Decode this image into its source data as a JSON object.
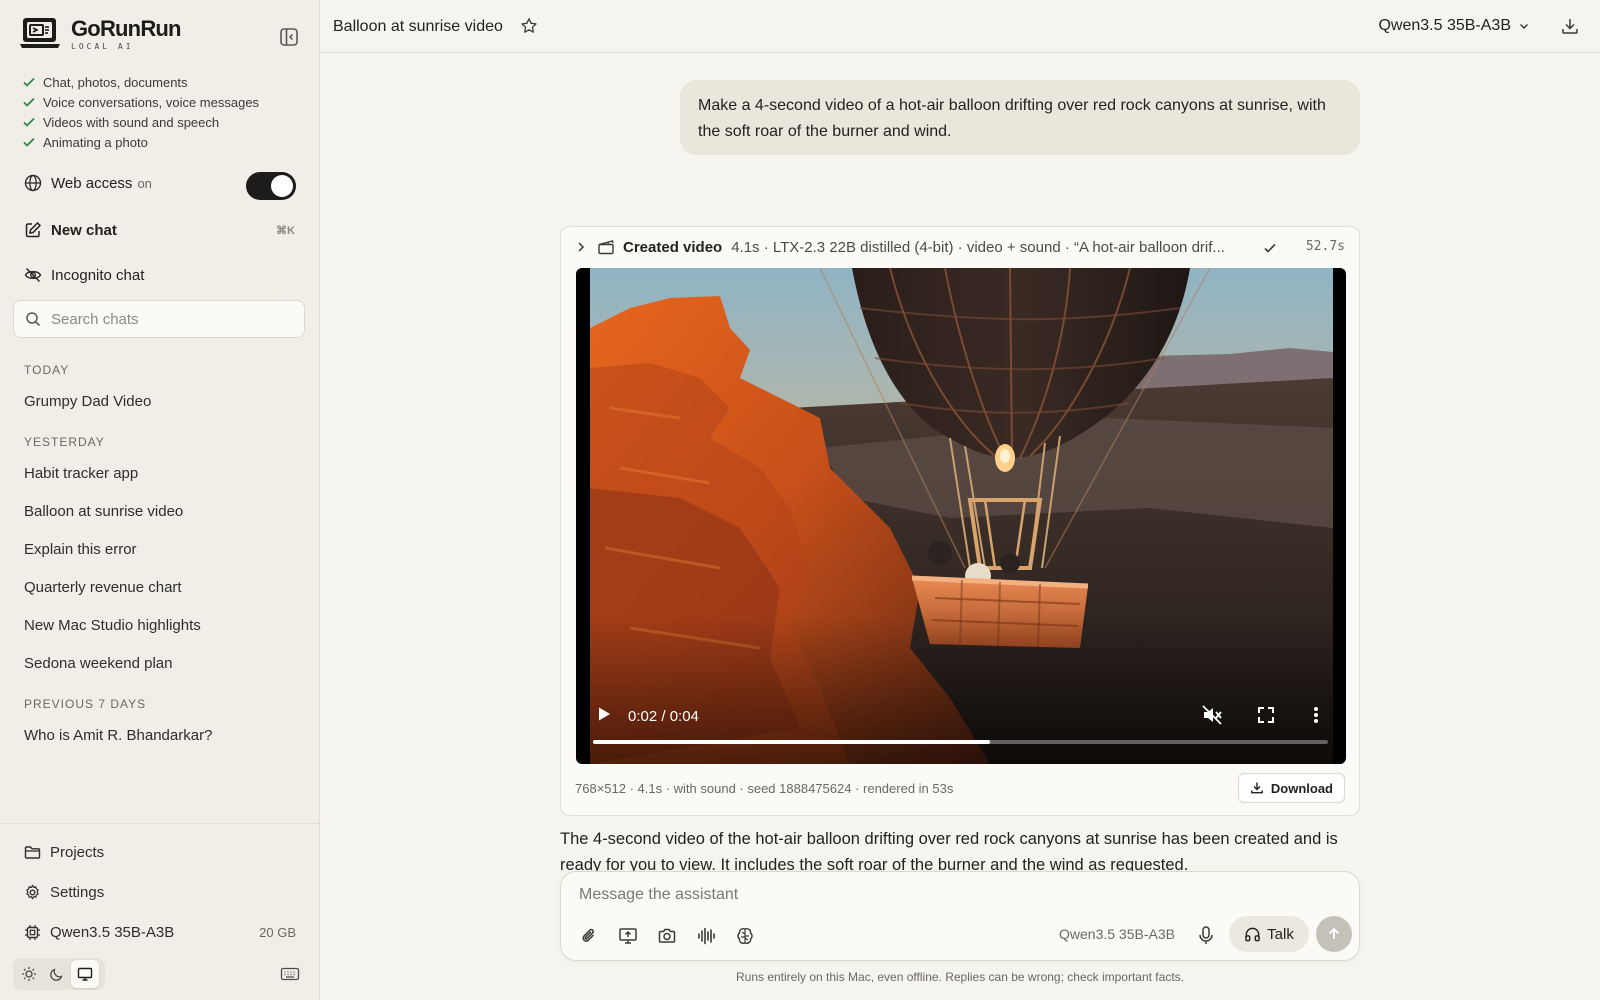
{
  "app": {
    "name": "GoRunRun",
    "tagline": "LOCAL AI"
  },
  "sidebar": {
    "features": [
      "Chat, photos, documents",
      "Voice conversations, voice messages",
      "Videos with sound and speech",
      "Animating a photo"
    ],
    "web_access": {
      "label": "Web access",
      "state": "on",
      "enabled": true
    },
    "new_chat": {
      "label": "New chat",
      "shortcut": "⌘K"
    },
    "incognito": {
      "label": "Incognito chat"
    },
    "search": {
      "placeholder": "Search chats"
    },
    "sections": [
      {
        "label": "TODAY",
        "items": [
          "Grumpy Dad Video"
        ]
      },
      {
        "label": "YESTERDAY",
        "items": [
          "Habit tracker app",
          "Balloon at sunrise video",
          "Explain this error",
          "Quarterly revenue chart",
          "New Mac Studio highlights",
          "Sedona weekend plan"
        ]
      },
      {
        "label": "PREVIOUS 7 DAYS",
        "items": [
          "Who is Amit R. Bhandarkar?"
        ]
      }
    ],
    "bottom": {
      "projects": "Projects",
      "settings": "Settings",
      "model": "Qwen3.5 35B-A3B",
      "model_size": "20 GB"
    },
    "theme": {
      "selected": "system",
      "options": [
        "light",
        "dark",
        "system"
      ]
    }
  },
  "header": {
    "title": "Balloon at sunrise video",
    "model": "Qwen3.5 35B-A3B"
  },
  "conversation": {
    "user_message": "Make a 4-second video of a hot-air balloon drifting over red rock canyons at sunrise, with the soft roar of the burner and wind.",
    "tool_card": {
      "title": "Created video",
      "meta": "4.1s · LTX-2.3 22B distilled (4-bit) · video + sound · “A hot-air balloon drif...",
      "elapsed": "52.7s",
      "video": {
        "time": "0:02 / 0:04",
        "progress": 0.54,
        "muted": true
      },
      "footer": "768×512 · 4.1s · with sound · seed 1888475624 · rendered in 53s",
      "download_label": "Download"
    },
    "assistant_message": "The 4-second video of the hot-air balloon drifting over red rock canyons at sunrise has been created and is ready for you to view. It includes the soft roar of the burner and the wind as requested."
  },
  "composer": {
    "placeholder": "Message the assistant",
    "model": "Qwen3.5 35B-A3B",
    "talk_label": "Talk",
    "tools": [
      "paperclip-icon",
      "screen-share-icon",
      "camera-icon",
      "waveform-icon",
      "brain-icon"
    ]
  },
  "disclaimer": "Runs entirely on this Mac, even offline. Replies can be wrong; check important facts.",
  "colors": {
    "background": "#f6f4ee",
    "sidebar": "#f0eee7",
    "check": "#2e8a4a",
    "toggle": "#1d1c1a",
    "bubble": "#e9e6dc"
  }
}
